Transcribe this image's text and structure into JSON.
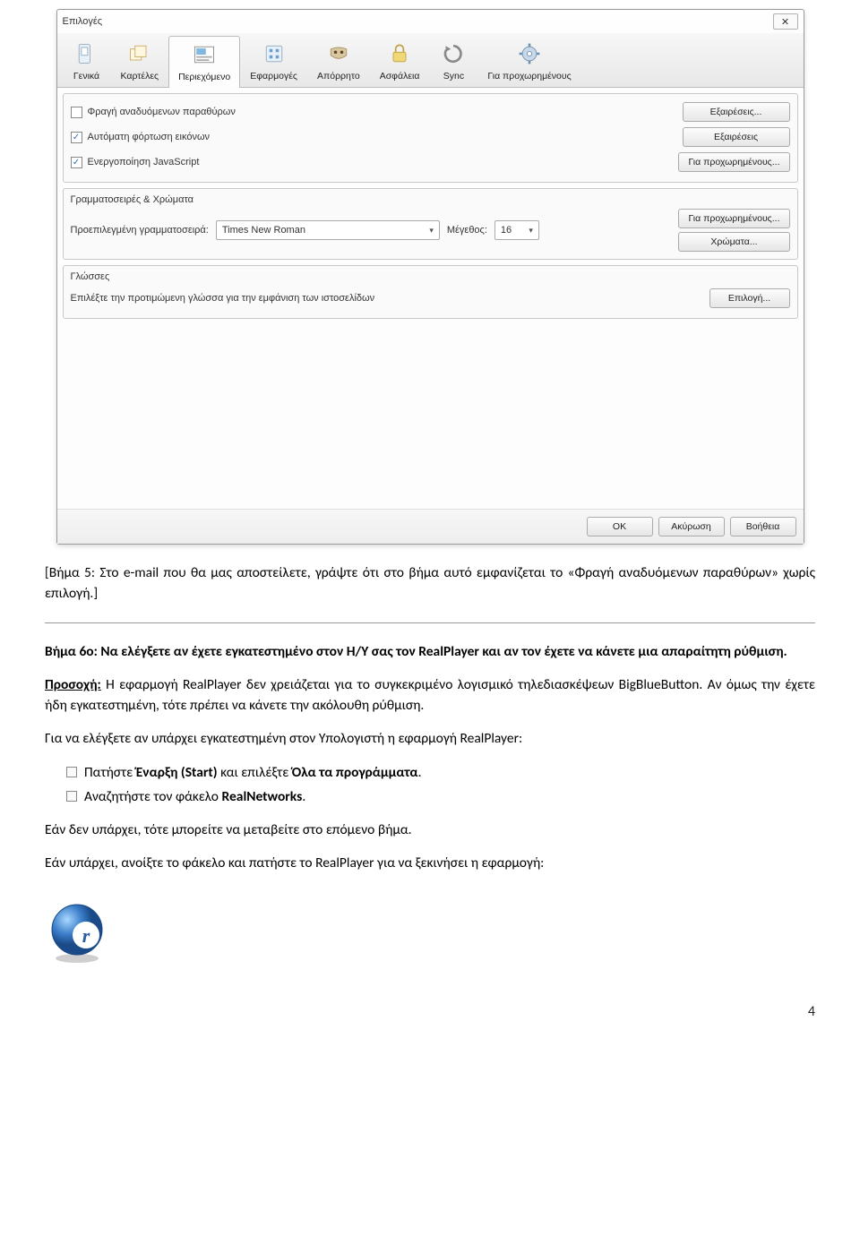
{
  "dialog": {
    "title": "Επιλογές",
    "close_glyph": "✕",
    "tabs": [
      {
        "label": "Γενικά"
      },
      {
        "label": "Καρτέλες"
      },
      {
        "label": "Περιεχόμενο"
      },
      {
        "label": "Εφαρμογές"
      },
      {
        "label": "Απόρρητο"
      },
      {
        "label": "Ασφάλεια"
      },
      {
        "label": "Sync"
      },
      {
        "label": "Για προχωρημένους"
      }
    ],
    "content": {
      "popups_label": "Φραγή αναδυόμενων παραθύρων",
      "popups_btn": "Εξαιρέσεις...",
      "images_label": "Αυτόματη φόρτωση εικόνων",
      "images_btn": "Εξαιρέσεις",
      "js_label": "Ενεργοποίηση JavaScript",
      "js_btn": "Για προχωρημένους...",
      "fonts_title": "Γραμματοσειρές & Χρώματα",
      "default_font_label": "Προεπιλεγμένη γραμματοσειρά:",
      "font_value": "Times New Roman",
      "size_label": "Μέγεθος:",
      "size_value": "16",
      "fonts_advanced_btn": "Για προχωρημένους...",
      "colors_btn": "Χρώματα...",
      "lang_title": "Γλώσσες",
      "lang_desc": "Επιλέξτε την προτιμώμενη γλώσσα για την εμφάνιση των ιστοσελίδων",
      "lang_btn": "Επιλογή..."
    },
    "footer": {
      "ok": "OK",
      "cancel": "Ακύρωση",
      "help": "Βοήθεια"
    }
  },
  "doc": {
    "step5": "[Βήμα 5: Στο e-mail που θα μας αποστείλετε, γράψτε ότι στο βήμα αυτό εμφανίζεται το «Φραγή αναδυόμενων παραθύρων» χωρίς επιλογή.]",
    "step6_title": "Βήμα 6ο: Να ελέγξετε αν έχετε εγκατεστημένο στον Η/Υ σας τον RealPlayer και αν τον έχετε να κάνετε μια απαραίτητη ρύθμιση.",
    "caution_label": "Προσοχή:",
    "caution_text": " Η εφαρμογή RealPlayer δεν χρειάζεται για το συγκεκριμένο λογισμικό τηλεδιασκέψεων BigBlueButton. Αν όμως την έχετε ήδη εγκατεστημένη, τότε πρέπει να κάνετε την ακόλουθη ρύθμιση.",
    "check_line": "Για να ελέγξετε αν υπάρχει εγκατεστημένη στον Υπολογιστή η εφαρμογή RealPlayer:",
    "li1_a": "Πατήστε ",
    "li1_b": "Έναρξη (Start)",
    "li1_c": " και επιλέξτε ",
    "li1_d": "Όλα τα προγράμματα",
    "li1_e": ".",
    "li2_a": "Αναζητήστε τον φάκελο ",
    "li2_b": "RealNetworks",
    "li2_c": ".",
    "not_exists": "Εάν δεν υπάρχει, τότε μπορείτε να μεταβείτε στο επόμενο βήμα.",
    "exists": "Εάν υπάρχει, ανοίξτε το φάκελο και πατήστε το RealPlayer για να ξεκινήσει η εφαρμογή:",
    "pagenum": "4"
  }
}
